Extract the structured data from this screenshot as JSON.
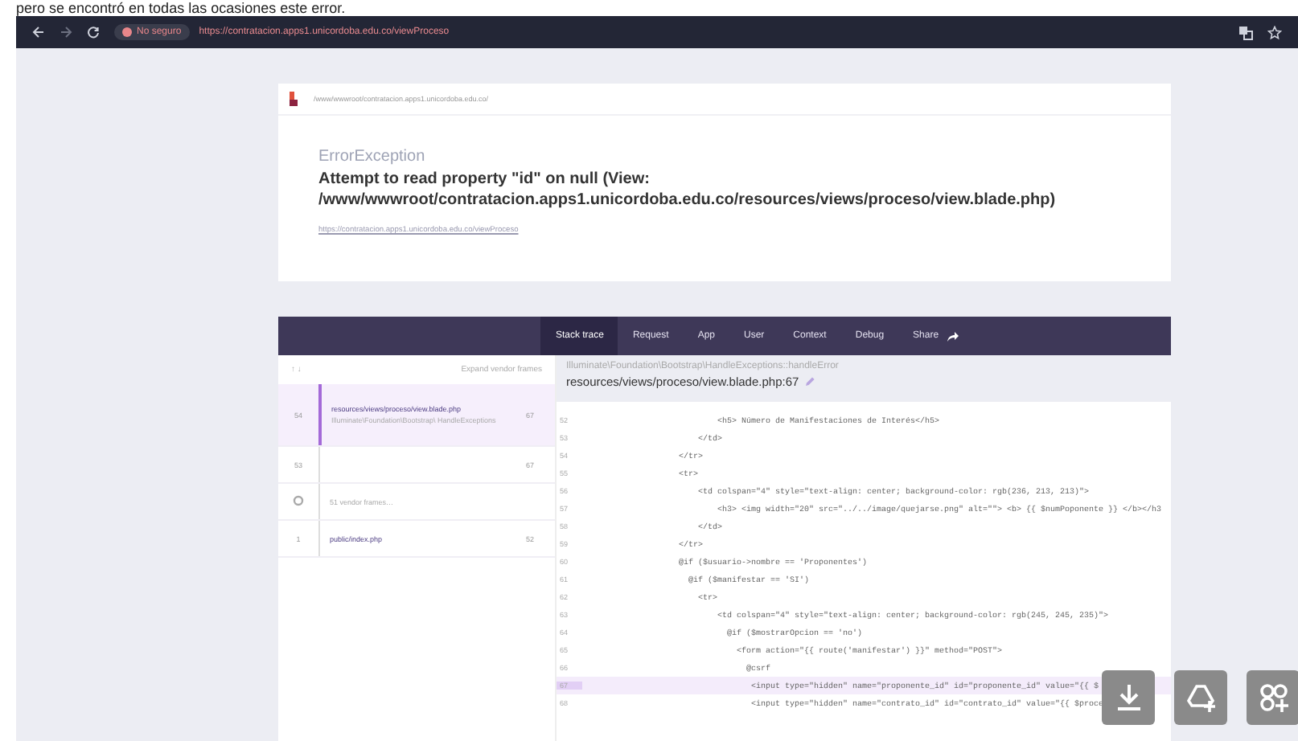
{
  "caption": "pero se encontró en todas las ocasiones este error.",
  "browser": {
    "security": "No seguro",
    "url": "https://contratacion.apps1.unicordoba.edu.co/viewProceso"
  },
  "error": {
    "path": "/www/wwwroot/contratacion.apps1.unicordoba.edu.co/",
    "type": "ErrorException",
    "message": "Attempt to read property \"id\" on null (View: /www/wwwroot/contratacion.apps1.unicordoba.edu.co/resources/views/proceso/view.blade.php)",
    "url": "https://contratacion.apps1.unicordoba.edu.co/viewProceso"
  },
  "tabs": [
    {
      "label": "Stack trace",
      "selected": true
    },
    {
      "label": "Request",
      "selected": false
    },
    {
      "label": "App",
      "selected": false
    },
    {
      "label": "User",
      "selected": false
    },
    {
      "label": "Context",
      "selected": false
    },
    {
      "label": "Debug",
      "selected": false
    },
    {
      "label": "Share",
      "selected": false
    }
  ],
  "frames_header": {
    "arrows": "↑ ↓",
    "expand": "Expand vendor frames"
  },
  "frames": [
    {
      "kind": "frame",
      "number": "54",
      "file": "resources/views/proceso/view.blade.php",
      "class": "Illuminate\\Foundation\\Bootstrap\\ HandleExceptions",
      "line": "67",
      "selected": true
    },
    {
      "kind": "frame",
      "number": "53",
      "line": "67",
      "selected": false
    },
    {
      "kind": "vendor",
      "file": "51 vendor frames…",
      "selected": false
    },
    {
      "kind": "frame",
      "number": "1",
      "file": "public/index.php",
      "line": "52",
      "selected": false
    }
  ],
  "source": {
    "class": "Illuminate\\Foundation\\Bootstrap\\HandleExceptions::handleError",
    "file": "resources/views/proceso/view.blade.php:67"
  },
  "code": [
    {
      "number": "52",
      "text": "                            <h5> Número de Manifestaciones de Interés</h5>",
      "highlighted": false
    },
    {
      "number": "53",
      "text": "                        </td>",
      "highlighted": false
    },
    {
      "number": "54",
      "text": "                    </tr>",
      "highlighted": false
    },
    {
      "number": "55",
      "text": "                    <tr>",
      "highlighted": false
    },
    {
      "number": "56",
      "text": "                        <td colspan=\"4\" style=\"text-align: center; background-color: rgb(236, 213, 213)\">",
      "highlighted": false
    },
    {
      "number": "57",
      "text": "                            <h3> <img width=\"20\" src=\"../../image/quejarse.png\" alt=\"\"> <b> {{ $numPoponente }} </b></h3",
      "highlighted": false
    },
    {
      "number": "58",
      "text": "                        </td>",
      "highlighted": false
    },
    {
      "number": "59",
      "text": "                    </tr>",
      "highlighted": false
    },
    {
      "number": "60",
      "text": "                    @if ($usuario->nombre == 'Proponentes')",
      "highlighted": false
    },
    {
      "number": "61",
      "text": "                      @if ($manifestar == 'SI')",
      "highlighted": false
    },
    {
      "number": "62",
      "text": "                        <tr>",
      "highlighted": false
    },
    {
      "number": "63",
      "text": "                            <td colspan=\"4\" style=\"text-align: center; background-color: rgb(245, 245, 235)\">",
      "highlighted": false
    },
    {
      "number": "64",
      "text": "                              @if ($mostrarOpcion == 'no')",
      "highlighted": false
    },
    {
      "number": "65",
      "text": "                                <form action=\"{{ route('manifestar') }}\" method=\"POST\">",
      "highlighted": false
    },
    {
      "number": "66",
      "text": "                                  @csrf",
      "highlighted": false
    },
    {
      "number": "67",
      "text": "                                   <input type=\"hidden\" name=\"proponente_id\" id=\"proponente_id\" value=\"{{ $",
      "highlighted": true
    },
    {
      "number": "68",
      "text": "                                   <input type=\"hidden\" name=\"contrato_id\" id=\"contrato_id\" value=\"{{ $proce",
      "highlighted": false
    }
  ]
}
